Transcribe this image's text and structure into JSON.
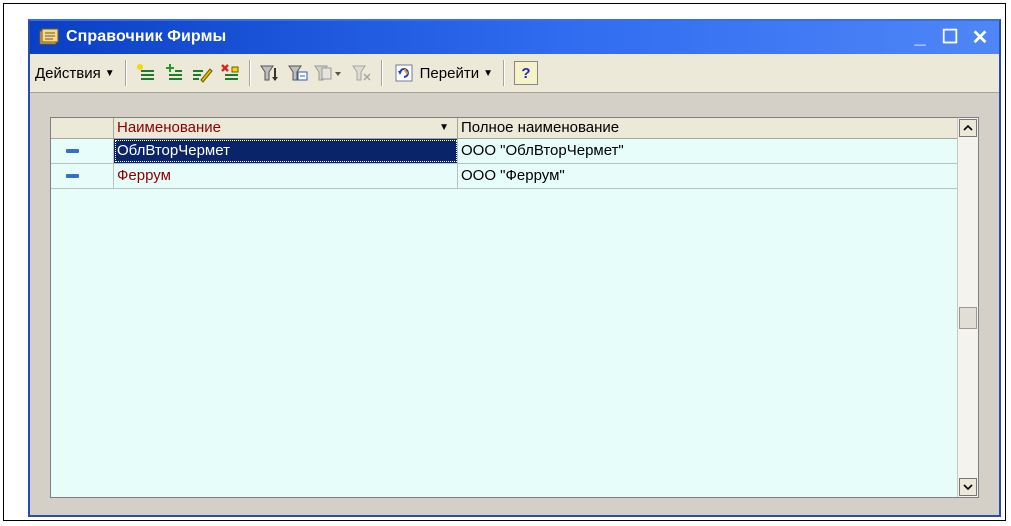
{
  "window": {
    "title": "Справочник Фирмы",
    "controls": {
      "minimize": "_",
      "maximize": "☐",
      "close": "✕"
    }
  },
  "toolbar": {
    "actions_label": "Действия",
    "goto_label": "Перейти",
    "help_label": "?",
    "icons": [
      "new-item-icon",
      "new-group-icon",
      "edit-icon",
      "delete-icon",
      "filter-icon",
      "filter-value-icon",
      "filter-history-icon",
      "clear-filter-icon",
      "refresh-icon"
    ]
  },
  "table": {
    "columns": [
      "Наименование",
      "Полное наименование"
    ],
    "rows": [
      {
        "name": "ОблВторЧермет",
        "full_name": "ООО \"ОблВторЧермет\"",
        "selected": true
      },
      {
        "name": "Феррум",
        "full_name": "ООО \"Феррум\"",
        "selected": false
      }
    ]
  },
  "colors": {
    "title_gradient_start": "#0a3fc4",
    "row_bg": "#e6fdfa",
    "selection": "#0a246a",
    "name_text": "#8b0000"
  }
}
